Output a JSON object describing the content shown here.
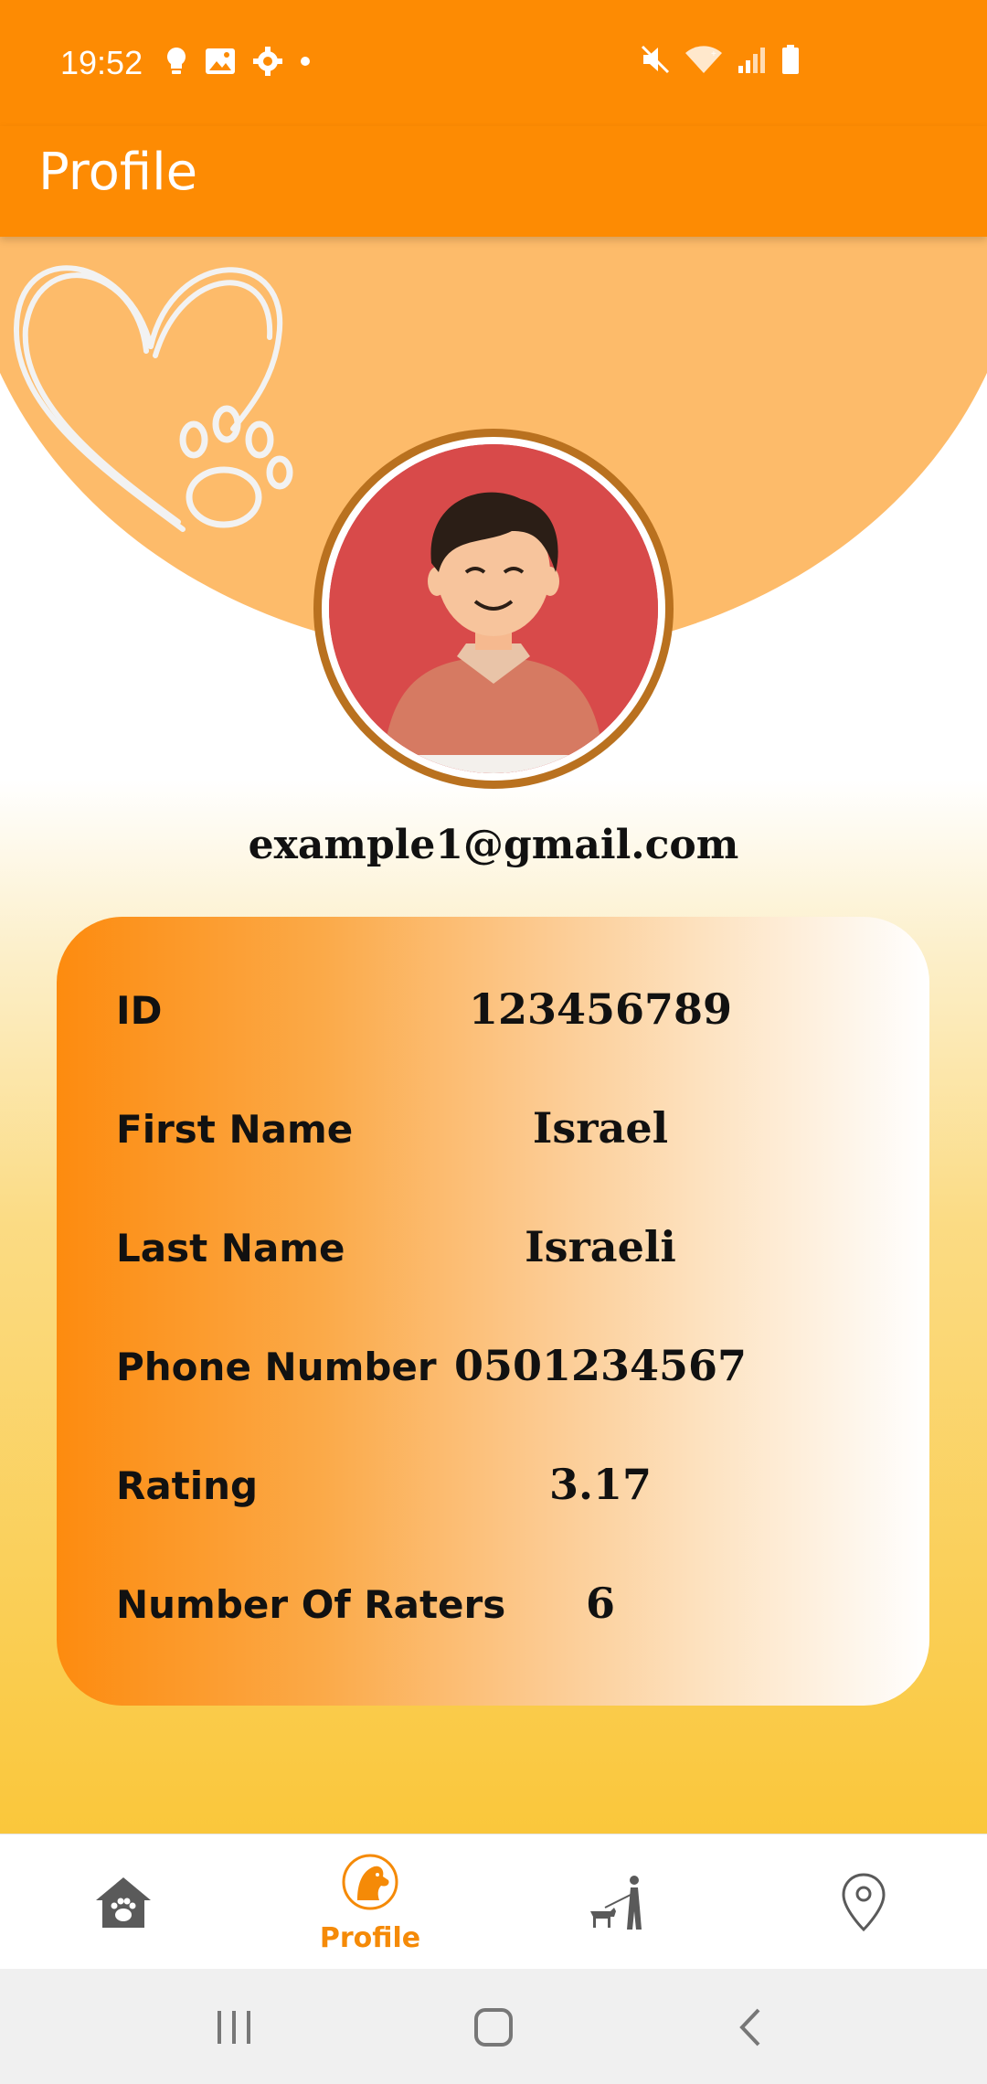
{
  "status_bar": {
    "time": "19:52",
    "left_icons": [
      "bulb-icon",
      "image-icon",
      "settings-icon",
      "dot-icon"
    ],
    "right_icons": [
      "mute-icon",
      "wifi-icon",
      "signal-icon",
      "battery-icon"
    ]
  },
  "app_bar": {
    "title": "Profile"
  },
  "profile": {
    "email": "example1@gmail.com",
    "fields": [
      {
        "label": "ID",
        "value": "123456789"
      },
      {
        "label": "First Name",
        "value": "Israel"
      },
      {
        "label": "Last Name",
        "value": "Israeli"
      },
      {
        "label": "Phone Number",
        "value": "0501234567"
      },
      {
        "label": "Rating",
        "value": "3.17"
      },
      {
        "label": "Number Of Raters",
        "value": "6"
      }
    ]
  },
  "bottom_nav": {
    "items": [
      {
        "icon": "home-paw-icon",
        "label": ""
      },
      {
        "icon": "dog-profile-icon",
        "label": "Profile"
      },
      {
        "icon": "dog-walker-icon",
        "label": ""
      },
      {
        "icon": "location-pin-icon",
        "label": ""
      }
    ],
    "active_index": 1
  },
  "system_nav": {
    "buttons": [
      "recents-icon",
      "home-icon",
      "back-icon"
    ]
  },
  "colors": {
    "primary": "#FD8B03",
    "header_blob": "#FDBB6A",
    "avatar_ring": "#B9711F",
    "active_nav": "#F58A07"
  }
}
